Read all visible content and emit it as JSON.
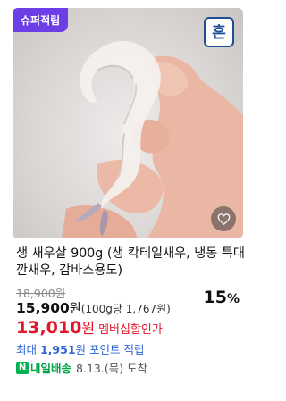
{
  "product": {
    "badge": "슈퍼적립",
    "logo_text": "흔",
    "title": "생 새우살 900g (생 칵테일새우, 냉동 특대 깐새우, 감바스용도)",
    "original_price": "18,900원",
    "price": "15,900",
    "price_unit": "원",
    "unit_price": "(100g당 1,767원)",
    "discount_value": "15",
    "discount_pct": "%",
    "member_price": "13,010",
    "member_won": "원",
    "member_label": "멤버십할인가",
    "points_prefix": "최대 ",
    "points_amount": "1,951",
    "points_suffix": "원 포인트 적립",
    "npay_icon": "N",
    "delivery_label": "내일배송",
    "delivery_date": "8.13.(목) 도착"
  },
  "colors": {
    "badge_bg": "#6c3ee6",
    "member_red": "#e0162b",
    "points_blue": "#2f66d4",
    "delivery_green": "#03a34a"
  },
  "icons": {
    "wishlist": "heart-outline-icon",
    "delivery": "naver-delivery-icon"
  }
}
